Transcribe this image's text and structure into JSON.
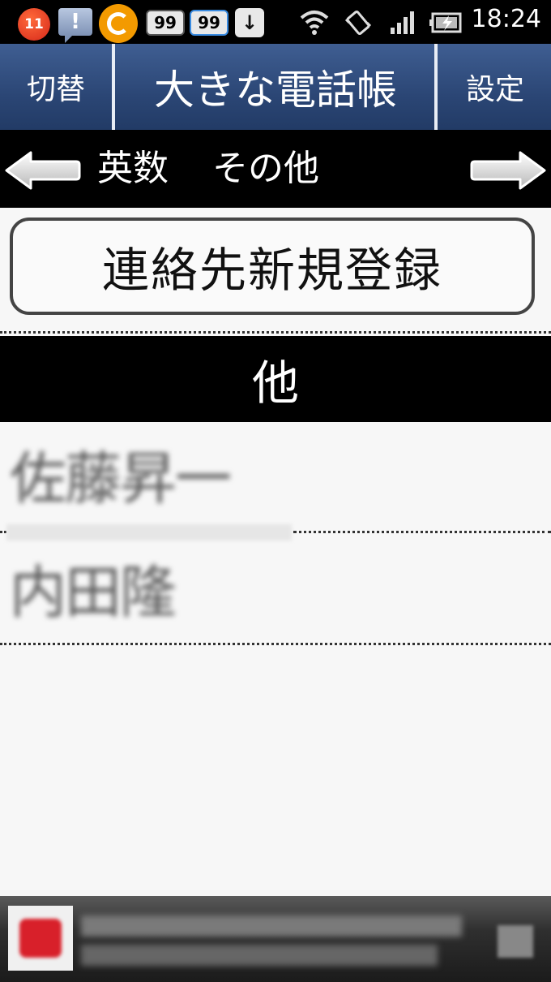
{
  "status_bar": {
    "notification_count": "11",
    "message_glyph": "!",
    "badge_a": "99",
    "badge_b": "99",
    "download_glyph": "↓",
    "time": "18:24",
    "icons": [
      "badge-icon",
      "message-icon",
      "ring-icon",
      "badge-99-icon",
      "badge-99-blue-icon",
      "download-icon",
      "wifi-icon",
      "vibrate-icon",
      "signal-icon",
      "battery-charging-icon"
    ]
  },
  "titlebar": {
    "switch_label": "切替",
    "title": "大きな電話帳",
    "settings_label": "設定"
  },
  "index_nav": {
    "left_arrow": "arrow-left-icon",
    "labels": [
      "英数",
      "その他"
    ],
    "right_arrow": "arrow-right-icon"
  },
  "new_contact": {
    "label": "連絡先新規登録"
  },
  "section": {
    "header": "他"
  },
  "contacts": [
    {
      "name": "佐藤昇一"
    },
    {
      "name": "内田隆"
    }
  ],
  "ad": {
    "thumb_icon": "ad-thumb-icon",
    "close_icon": "ad-close-icon"
  },
  "colors": {
    "titlebar": "#2b4675",
    "nav_background": "#000000",
    "page_background": "#f7f7f7"
  }
}
